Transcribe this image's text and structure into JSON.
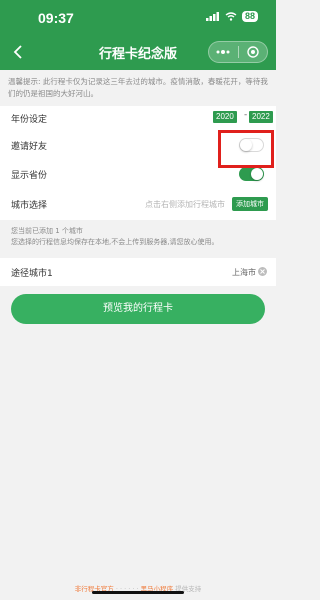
{
  "status_bar": {
    "time": "09:37",
    "battery": "88"
  },
  "nav": {
    "title": "行程卡纪念版"
  },
  "notice": "温馨提示: 此行程卡仅为记录这三年去过的城市。疫情消散，春暖花开，等待我们的仍是祖国的大好河山。",
  "settings": {
    "year": {
      "label": "年份设定",
      "start": "2020",
      "dash": "-",
      "end": "2022"
    },
    "invite": {
      "label": "邀请好友",
      "enabled": false
    },
    "province": {
      "label": "显示省份",
      "enabled": true
    },
    "city": {
      "label": "城市选择",
      "hint": "点击右侧添加行程城市",
      "button": "添加城市"
    }
  },
  "info": {
    "line1": "您当前已添加 1 个城市",
    "line2": "您选择的行程信息均保存在本地,不会上传到服务器,请您放心使用。"
  },
  "cities": [
    {
      "label": "途径城市1",
      "value": "上海市"
    }
  ],
  "preview_button": "预览我的行程卡",
  "footer": {
    "part1": "非行程卡官方",
    "part2": "· · · · · ·",
    "part3": "黑马小程序 ",
    "part4": "提供支持"
  },
  "colors": {
    "primary": "#2e9b4f",
    "highlight": "#e0201c"
  }
}
